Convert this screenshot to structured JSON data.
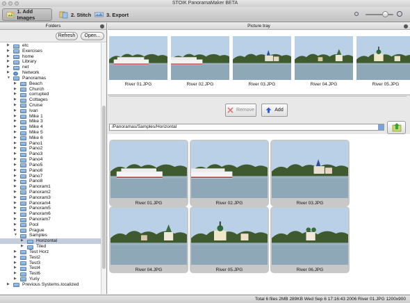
{
  "window": {
    "title": "STOIK PanoramaMaker BETA"
  },
  "toolbar": {
    "steps": [
      {
        "label": "1. Add Images"
      },
      {
        "label": "2. Stitch"
      },
      {
        "label": "3. Export"
      }
    ],
    "zoom_level": 0.75
  },
  "folders": {
    "title": "Folders",
    "refresh_label": "Refresh",
    "open_label": "Open...",
    "tree": [
      {
        "label": "etc",
        "depth": 0,
        "state": "collapsed"
      },
      {
        "label": "Exercises",
        "depth": 0,
        "state": "collapsed"
      },
      {
        "label": "home",
        "depth": 0,
        "state": "collapsed"
      },
      {
        "label": "Library",
        "depth": 0,
        "state": "collapsed"
      },
      {
        "label": "net",
        "depth": 0,
        "state": "collapsed"
      },
      {
        "label": "Network",
        "depth": 0,
        "state": "collapsed",
        "icon": "network"
      },
      {
        "label": "Panoramas",
        "depth": 0,
        "state": "expanded"
      },
      {
        "label": "Beach",
        "depth": 1,
        "state": "collapsed"
      },
      {
        "label": "Church",
        "depth": 1,
        "state": "collapsed"
      },
      {
        "label": "corrupted",
        "depth": 1,
        "state": "collapsed"
      },
      {
        "label": "Cottages",
        "depth": 1,
        "state": "collapsed"
      },
      {
        "label": "Cruise",
        "depth": 1,
        "state": "collapsed"
      },
      {
        "label": "Ivan",
        "depth": 1,
        "state": "collapsed"
      },
      {
        "label": "Mike 1",
        "depth": 1,
        "state": "collapsed"
      },
      {
        "label": "Mike 3",
        "depth": 1,
        "state": "collapsed"
      },
      {
        "label": "Mike 4",
        "depth": 1,
        "state": "collapsed"
      },
      {
        "label": "Mike 5",
        "depth": 1,
        "state": "collapsed"
      },
      {
        "label": "Mike 6",
        "depth": 1,
        "state": "collapsed"
      },
      {
        "label": "Pano1",
        "depth": 1,
        "state": "collapsed"
      },
      {
        "label": "Pano2",
        "depth": 1,
        "state": "collapsed"
      },
      {
        "label": "Pano3",
        "depth": 1,
        "state": "collapsed"
      },
      {
        "label": "Pano4",
        "depth": 1,
        "state": "collapsed"
      },
      {
        "label": "Pano5",
        "depth": 1,
        "state": "collapsed"
      },
      {
        "label": "Pano6",
        "depth": 1,
        "state": "collapsed"
      },
      {
        "label": "Pano7",
        "depth": 1,
        "state": "collapsed"
      },
      {
        "label": "Pano8",
        "depth": 1,
        "state": "collapsed"
      },
      {
        "label": "Panoram1",
        "depth": 1,
        "state": "collapsed"
      },
      {
        "label": "Panoram2",
        "depth": 1,
        "state": "collapsed"
      },
      {
        "label": "Panoram3",
        "depth": 1,
        "state": "collapsed"
      },
      {
        "label": "Panoram4",
        "depth": 1,
        "state": "collapsed"
      },
      {
        "label": "Panoram5",
        "depth": 1,
        "state": "collapsed"
      },
      {
        "label": "Panoram6",
        "depth": 1,
        "state": "collapsed"
      },
      {
        "label": "Panoram7",
        "depth": 1,
        "state": "collapsed"
      },
      {
        "label": "Pool",
        "depth": 1,
        "state": "collapsed"
      },
      {
        "label": "Prague",
        "depth": 1,
        "state": "collapsed"
      },
      {
        "label": "Samples",
        "depth": 1,
        "state": "expanded"
      },
      {
        "label": "Horizontal",
        "depth": 2,
        "state": "collapsed",
        "selected": true
      },
      {
        "label": "Tiled",
        "depth": 2,
        "state": "collapsed"
      },
      {
        "label": "Test Horz",
        "depth": 1,
        "state": "collapsed"
      },
      {
        "label": "Test2",
        "depth": 1,
        "state": "collapsed"
      },
      {
        "label": "Test3",
        "depth": 1,
        "state": "collapsed"
      },
      {
        "label": "Test4",
        "depth": 1,
        "state": "collapsed"
      },
      {
        "label": "Test6",
        "depth": 1,
        "state": "collapsed"
      },
      {
        "label": "Yuriy",
        "depth": 1,
        "state": "collapsed"
      },
      {
        "label": "Previous Systems.localized",
        "depth": 0,
        "state": "collapsed"
      }
    ]
  },
  "tray": {
    "title": "Picture tray",
    "items": [
      {
        "label": "River 01.JPG",
        "scene": "boat"
      },
      {
        "label": "River 02.JPG",
        "scene": "boat2"
      },
      {
        "label": "River 03.JPG",
        "scene": "church"
      },
      {
        "label": "River 04.JPG",
        "scene": "town"
      },
      {
        "label": "River 05.JPG",
        "scene": "domes"
      }
    ]
  },
  "actions": {
    "remove_label": "Remove",
    "add_label": "Add"
  },
  "path": {
    "value": "/Panoramas/Samples/Horizontal"
  },
  "browser": {
    "items": [
      {
        "label": "River 01.JPG",
        "scene": "boat"
      },
      {
        "label": "River 02.JPG",
        "scene": "boat2"
      },
      {
        "label": "River 03.JPG",
        "scene": "church"
      },
      {
        "label": "River 04.JPG",
        "scene": "town"
      },
      {
        "label": "River 05.JPG",
        "scene": "domes"
      },
      {
        "label": "River 06.JPG",
        "scene": "trees"
      }
    ]
  },
  "status": {
    "text": "Total 6 files   2MB  289KB Wed Sep 6 17:16:43 2006  River 01.JPG  1200x900"
  },
  "colors": {
    "selection": "#c5cddc",
    "accent": "#3a6fd0",
    "add_arrow": "#2a5bd8",
    "remove_x": "#d04040"
  }
}
